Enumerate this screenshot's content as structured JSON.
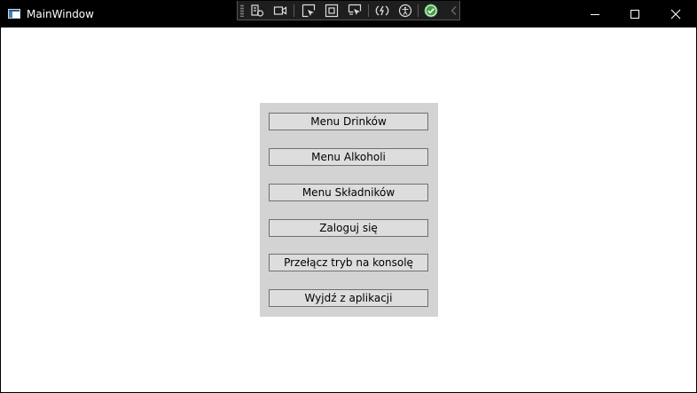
{
  "window": {
    "title": "MainWindow",
    "icons": {
      "app": "app-window-icon",
      "minimize": "minimize-icon",
      "maximize": "maximize-icon",
      "close": "close-icon"
    }
  },
  "debug_toolbar": {
    "items": [
      "live-visual-tree-icon",
      "record-icon",
      "select-element-icon",
      "display-layout-adorners-icon",
      "track-focused-element-icon",
      "hot-reload-icon",
      "accessibility-icon",
      "check-icon",
      "collapse-chevron-icon"
    ],
    "status_color": "#43a047"
  },
  "menu": {
    "buttons": [
      {
        "label": "Menu Drinków"
      },
      {
        "label": "Menu Alkoholi"
      },
      {
        "label": "Menu Składników"
      },
      {
        "label": "Zaloguj się"
      },
      {
        "label": "Przełącz tryb na konsolę"
      },
      {
        "label": "Wyjdź z aplikacji"
      }
    ]
  },
  "colors": {
    "titlebar": "#000000",
    "client_background": "#ffffff",
    "panel_background": "#d3d3d3",
    "button_background": "#dddddd",
    "button_border": "#707070"
  }
}
